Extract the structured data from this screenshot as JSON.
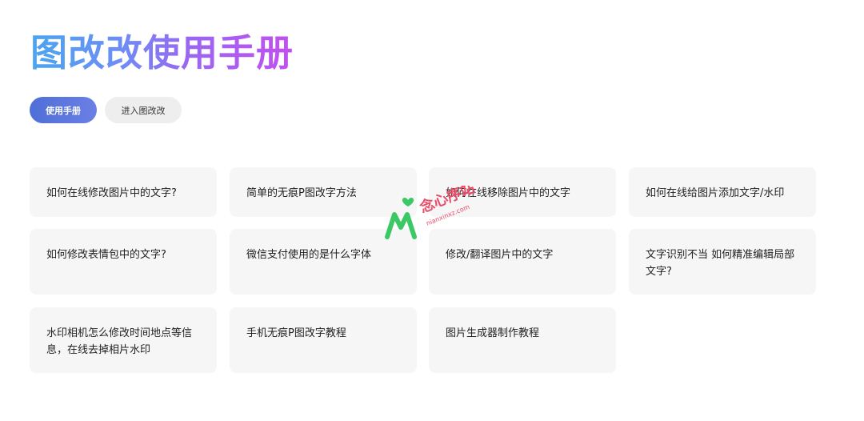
{
  "header": {
    "title": "图改改使用手册"
  },
  "tabs": [
    {
      "label": "使用手册",
      "active": true
    },
    {
      "label": "进入图改改",
      "active": false
    }
  ],
  "articles": [
    "如何在线修改图片中的文字?",
    "简单的无痕P图改字方法",
    "如何在线移除图片中的文字",
    "如何在线给图片添加文字/水印",
    "如何修改表情包中的文字?",
    "微信支付使用的是什么字体",
    "修改/翻译图片中的文字",
    "文字识别不当 如何精准编辑局部文字?",
    "水印相机怎么修改时间地点等信息，在线去掉相片水印",
    "手机无痕P图改字教程",
    "图片生成器制作教程"
  ],
  "watermark": {
    "brand": "念心序站",
    "url": "nianxinxz.com"
  },
  "colors": {
    "accent": "#5a74dc",
    "card_bg": "#f6f6f7",
    "watermark_green": "#3cc864"
  }
}
